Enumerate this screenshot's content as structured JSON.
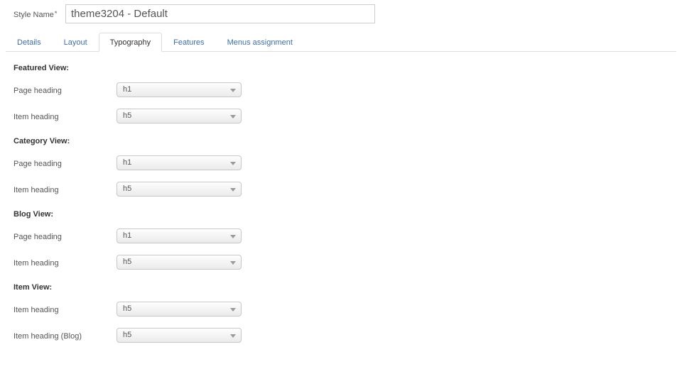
{
  "style_name": {
    "label": "Style Name",
    "required_marker": "*",
    "value": "theme3204 - Default"
  },
  "tabs": [
    {
      "label": "Details",
      "active": false
    },
    {
      "label": "Layout",
      "active": false
    },
    {
      "label": "Typography",
      "active": true
    },
    {
      "label": "Features",
      "active": false
    },
    {
      "label": "Menus assignment",
      "active": false
    }
  ],
  "sections": [
    {
      "title": "Featured View:",
      "fields": [
        {
          "label": "Page heading",
          "value": "h1"
        },
        {
          "label": "Item heading",
          "value": "h5"
        }
      ]
    },
    {
      "title": "Category View:",
      "fields": [
        {
          "label": "Page heading",
          "value": "h1"
        },
        {
          "label": "Item heading",
          "value": "h5"
        }
      ]
    },
    {
      "title": "Blog View:",
      "fields": [
        {
          "label": "Page heading",
          "value": "h1"
        },
        {
          "label": "Item heading",
          "value": "h5"
        }
      ]
    },
    {
      "title": "Item View:",
      "fields": [
        {
          "label": "Item heading",
          "value": "h5"
        },
        {
          "label": "Item heading (Blog)",
          "value": "h5"
        }
      ]
    }
  ],
  "colors": {
    "tab_link": "#3d6ea8",
    "tab_active_text": "#333333",
    "label_text": "#555555",
    "section_title": "#333333",
    "border": "#dddddd",
    "select_border": "#c7c7c7",
    "select_arrow": "#9a9a9a"
  },
  "icons": {
    "select_arrow": "chevron-down-icon"
  }
}
